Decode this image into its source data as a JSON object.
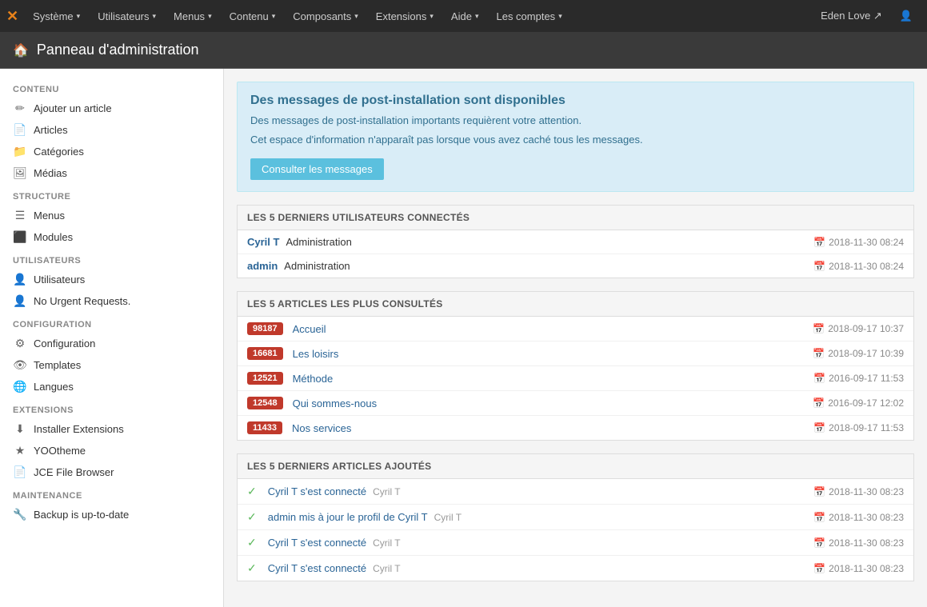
{
  "topnav": {
    "logo": "✕",
    "items": [
      {
        "label": "Système",
        "arrow": "▾"
      },
      {
        "label": "Utilisateurs",
        "arrow": "▾"
      },
      {
        "label": "Menus",
        "arrow": "▾"
      },
      {
        "label": "Contenu",
        "arrow": "▾"
      },
      {
        "label": "Composants",
        "arrow": "▾"
      },
      {
        "label": "Extensions",
        "arrow": "▾"
      },
      {
        "label": "Aide",
        "arrow": "▾"
      },
      {
        "label": "Les comptes",
        "arrow": "▾"
      }
    ],
    "user": "Eden Love ↗",
    "user_icon": "👤"
  },
  "admin_header": {
    "title": "Panneau d'administration",
    "home_icon": "🏠"
  },
  "sidebar": {
    "sections": [
      {
        "title": "CONTENU",
        "items": [
          {
            "icon": "✏",
            "label": "Ajouter un article"
          },
          {
            "icon": "📄",
            "label": "Articles"
          },
          {
            "icon": "📁",
            "label": "Catégories"
          },
          {
            "icon": "🖼",
            "label": "Médias"
          }
        ]
      },
      {
        "title": "STRUCTURE",
        "items": [
          {
            "icon": "☰",
            "label": "Menus"
          },
          {
            "icon": "⬛",
            "label": "Modules"
          }
        ]
      },
      {
        "title": "UTILISATEURS",
        "items": [
          {
            "icon": "👤",
            "label": "Utilisateurs"
          },
          {
            "icon": "👤",
            "label": "No Urgent Requests."
          }
        ]
      },
      {
        "title": "CONFIGURATION",
        "items": [
          {
            "icon": "⚙",
            "label": "Configuration"
          },
          {
            "icon": "👁",
            "label": "Templates"
          },
          {
            "icon": "🌐",
            "label": "Langues"
          }
        ]
      },
      {
        "title": "EXTENSIONS",
        "items": [
          {
            "icon": "⬇",
            "label": "Installer Extensions"
          },
          {
            "icon": "★",
            "label": "YOOtheme"
          },
          {
            "icon": "📄",
            "label": "JCE File Browser"
          }
        ]
      },
      {
        "title": "MAINTENANCE",
        "items": [
          {
            "icon": "🔧",
            "label": "Backup is up-to-date"
          }
        ]
      }
    ]
  },
  "alert": {
    "title": "Des messages de post-installation sont disponibles",
    "line1": "Des messages de post-installation importants requièrent votre attention.",
    "line2": "Cet espace d'information n'apparaît pas lorsque vous avez caché tous les messages.",
    "button": "Consulter les messages"
  },
  "panel_users": {
    "header": "LES 5 DERNIERS UTILISATEURS CONNECTÉS",
    "rows": [
      {
        "name": "Cyril T",
        "role": "Administration",
        "date": "2018-11-30 08:24"
      },
      {
        "name": "admin",
        "role": "Administration",
        "date": "2018-11-30 08:24"
      }
    ]
  },
  "panel_articles": {
    "header": "LES 5 ARTICLES LES PLUS CONSULTÉS",
    "rows": [
      {
        "count": "98187",
        "title": "Accueil",
        "date": "2018-09-17 10:37"
      },
      {
        "count": "16681",
        "title": "Les loisirs",
        "date": "2018-09-17 10:39"
      },
      {
        "count": "12521",
        "title": "Méthode",
        "date": "2016-09-17 11:53"
      },
      {
        "count": "12548",
        "title": "Qui sommes-nous",
        "date": "2016-09-17 12:02"
      },
      {
        "count": "11433",
        "title": "Nos services",
        "date": "2018-09-17 11:53"
      }
    ]
  },
  "panel_recent": {
    "header": "LES 5 DERNIERS ARTICLES AJOUTÉS",
    "rows": [
      {
        "check": "✓",
        "main": "Cyril T s'est connecté",
        "sub": "Cyril T",
        "date": "2018-11-30 08:23"
      },
      {
        "check": "✓",
        "main": "admin mis à jour le profil de Cyril T",
        "sub": "Cyril T",
        "date": "2018-11-30 08:23"
      },
      {
        "check": "✓",
        "main": "Cyril T s'est connecté",
        "sub": "Cyril T",
        "date": "2018-11-30 08:23"
      },
      {
        "check": "✓",
        "main": "Cyril T s'est connecté",
        "sub": "Cyril T",
        "date": "2018-11-30 08:23"
      }
    ]
  }
}
